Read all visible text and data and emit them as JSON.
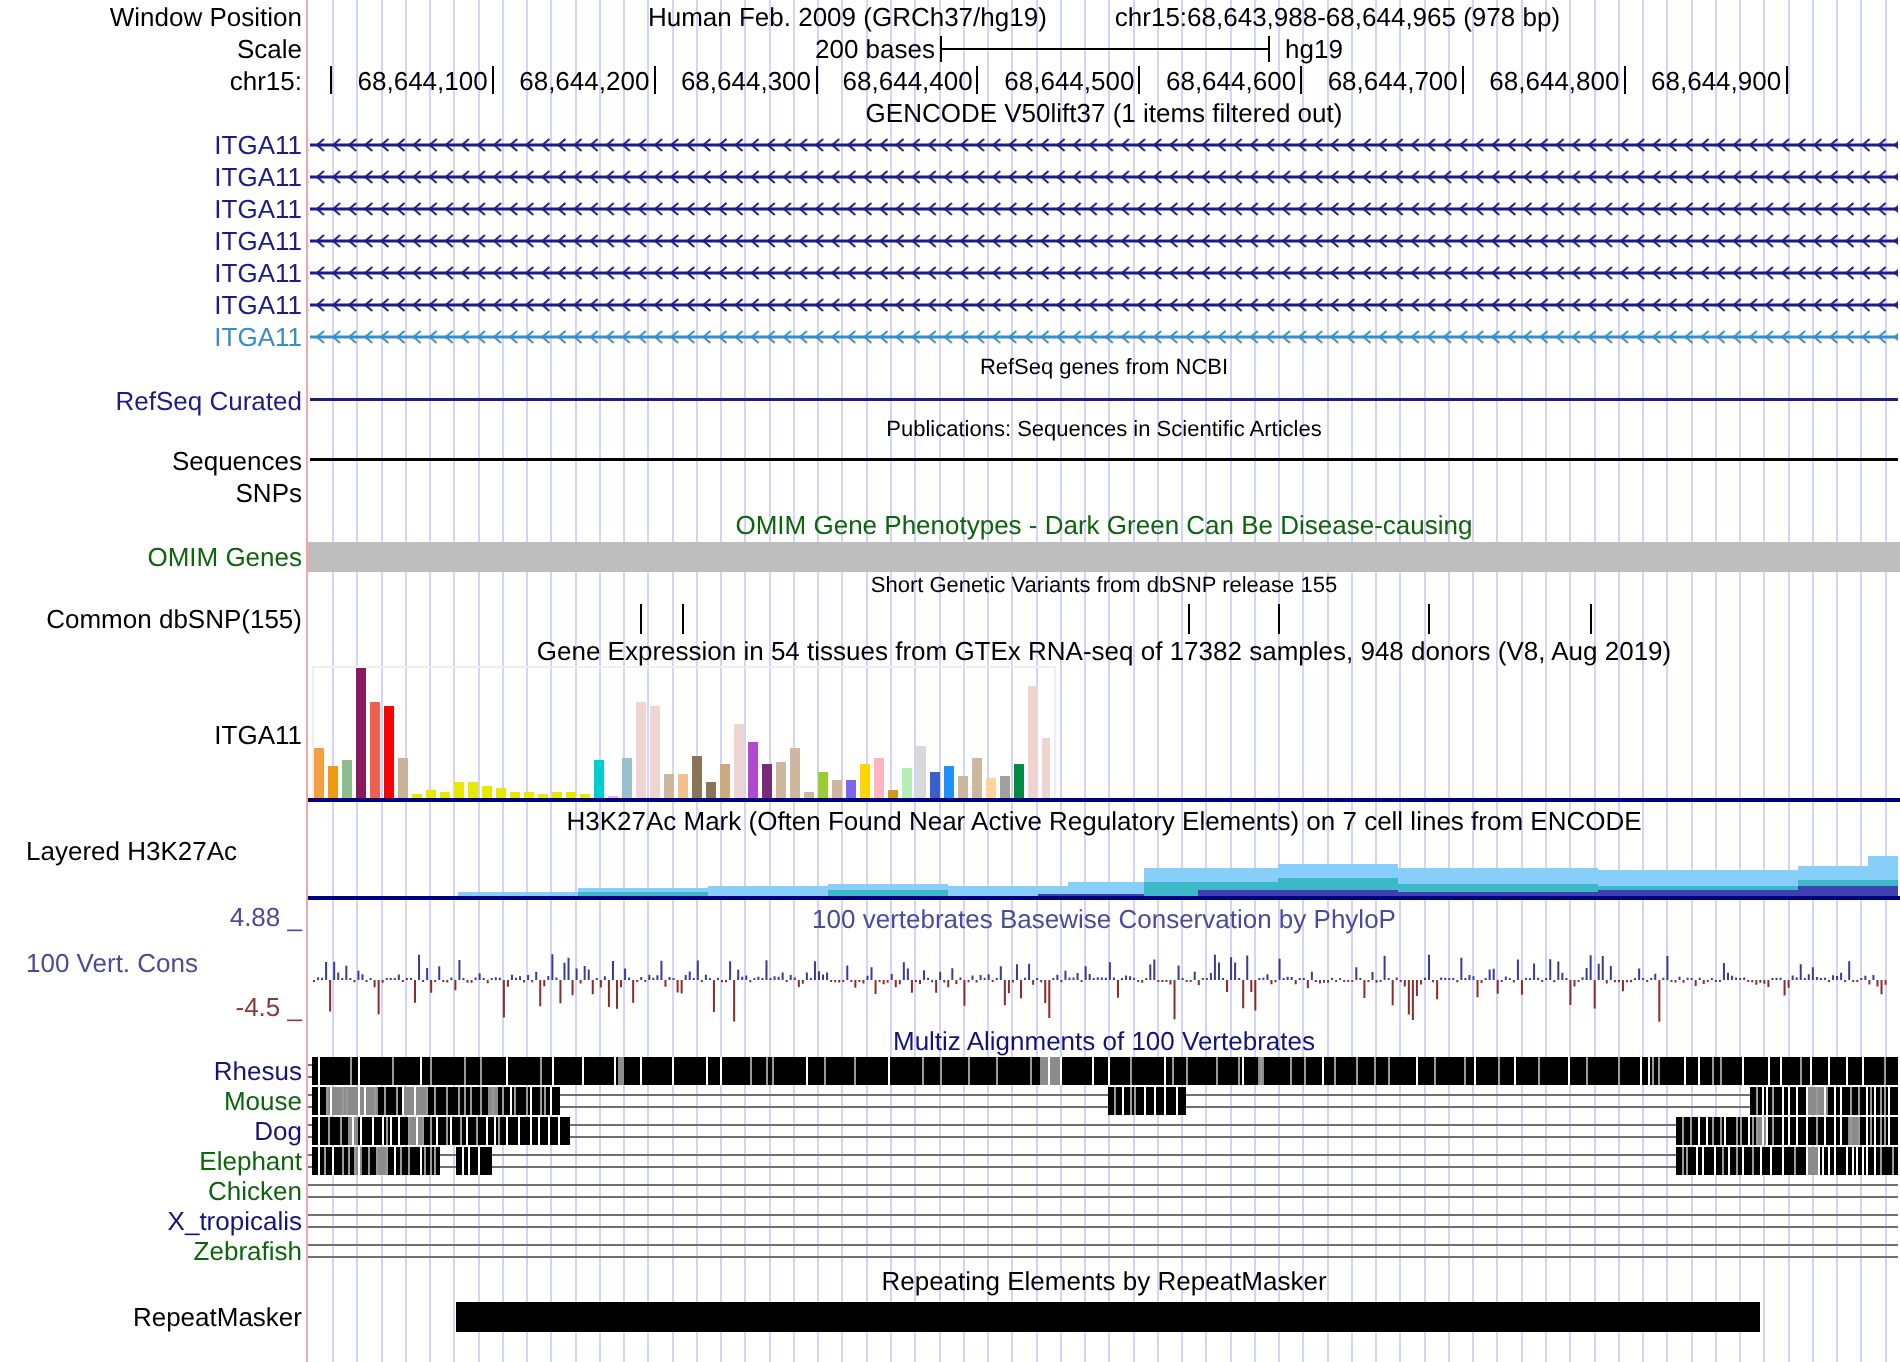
{
  "header": {
    "label": "Window Position",
    "assembly": "Human Feb. 2009 (GRCh37/hg19)",
    "position": "chr15:68,643,988-68,644,965 (978 bp)"
  },
  "scale": {
    "label": "Scale",
    "length": "200 bases",
    "assembly": "hg19"
  },
  "ruler": {
    "label": "chr15:",
    "ticks": [
      "68,644,100",
      "68,644,200",
      "68,644,300",
      "68,644,400",
      "68,644,500",
      "68,644,600",
      "68,644,700",
      "68,644,800",
      "68,644,900"
    ]
  },
  "tracks": [
    {
      "kind": "genes",
      "title": {
        "text": "GENCODE V50lift37 (1 items filtered out)",
        "color": "#000000"
      },
      "items": [
        {
          "label": "ITGA11",
          "color": "#1c1c84"
        },
        {
          "label": "ITGA11",
          "color": "#1c1c84"
        },
        {
          "label": "ITGA11",
          "color": "#1c1c84"
        },
        {
          "label": "ITGA11",
          "color": "#1c1c84"
        },
        {
          "label": "ITGA11",
          "color": "#1c1c84"
        },
        {
          "label": "ITGA11",
          "color": "#1c1c84"
        },
        {
          "label": "ITGA11",
          "color": "#3a8cc4"
        }
      ]
    },
    {
      "kind": "line",
      "title": {
        "text": "RefSeq genes from NCBI",
        "color": "#000000"
      },
      "label": "RefSeq Curated",
      "color": "#1c1c84"
    },
    {
      "kind": "line",
      "title": {
        "text": "Publications: Sequences in Scientific Articles",
        "color": "#000000"
      },
      "label": "Sequences",
      "color": "#000000"
    },
    {
      "kind": "empty",
      "label": "SNPs",
      "color": "#000000"
    },
    {
      "kind": "block",
      "title": {
        "text": "OMIM Gene Phenotypes - Dark Green Can Be Disease-causing",
        "color": "#0c640c"
      },
      "label": "OMIM Genes",
      "color": "#0c640c"
    },
    {
      "kind": "snps",
      "title": {
        "text": "Short Genetic Variants from dbSNP release 155",
        "color": "#000000"
      },
      "label": "Common dbSNP(155)",
      "color": "#000000"
    },
    {
      "kind": "expression",
      "title": {
        "text": "Gene Expression in 54 tissues from GTEx RNA-seq of 17382 samples, 948 donors (V8, Aug 2019)",
        "color": "#000000"
      },
      "label": "ITGA11",
      "color": "#000000"
    },
    {
      "kind": "layered",
      "title": {
        "text": "H3K27Ac Mark (Often Found Near Active Regulatory Elements) on 7 cell lines from ENCODE",
        "color": "#000000"
      },
      "label": "Layered H3K27Ac",
      "color": "#000000"
    },
    {
      "kind": "wiggle",
      "title": {
        "text": "100 vertebrates Basewise Conservation by PhyloP",
        "color": "#4a4a9a"
      },
      "label": "100 Vert. Cons",
      "color": "#4a4a9a",
      "max": "4.88 _",
      "min": "-4.5 _"
    },
    {
      "kind": "alignment",
      "title": {
        "text": "Multiz Alignments of 100 Vertebrates",
        "color": "#141478"
      },
      "species": [
        {
          "label": "Rhesus",
          "color": "#141478"
        },
        {
          "label": "Mouse",
          "color": "#0c640c"
        },
        {
          "label": "Dog",
          "color": "#141478"
        },
        {
          "label": "Elephant",
          "color": "#0c640c"
        },
        {
          "label": "Chicken",
          "color": "#0c640c"
        },
        {
          "label": "X_tropicalis",
          "color": "#141478"
        },
        {
          "label": "Zebrafish",
          "color": "#0c640c"
        }
      ]
    },
    {
      "kind": "repeats",
      "title": {
        "text": "Repeating Elements by RepeatMasker",
        "color": "#000000"
      },
      "label": "RepeatMasker",
      "color": "#000000"
    }
  ]
}
